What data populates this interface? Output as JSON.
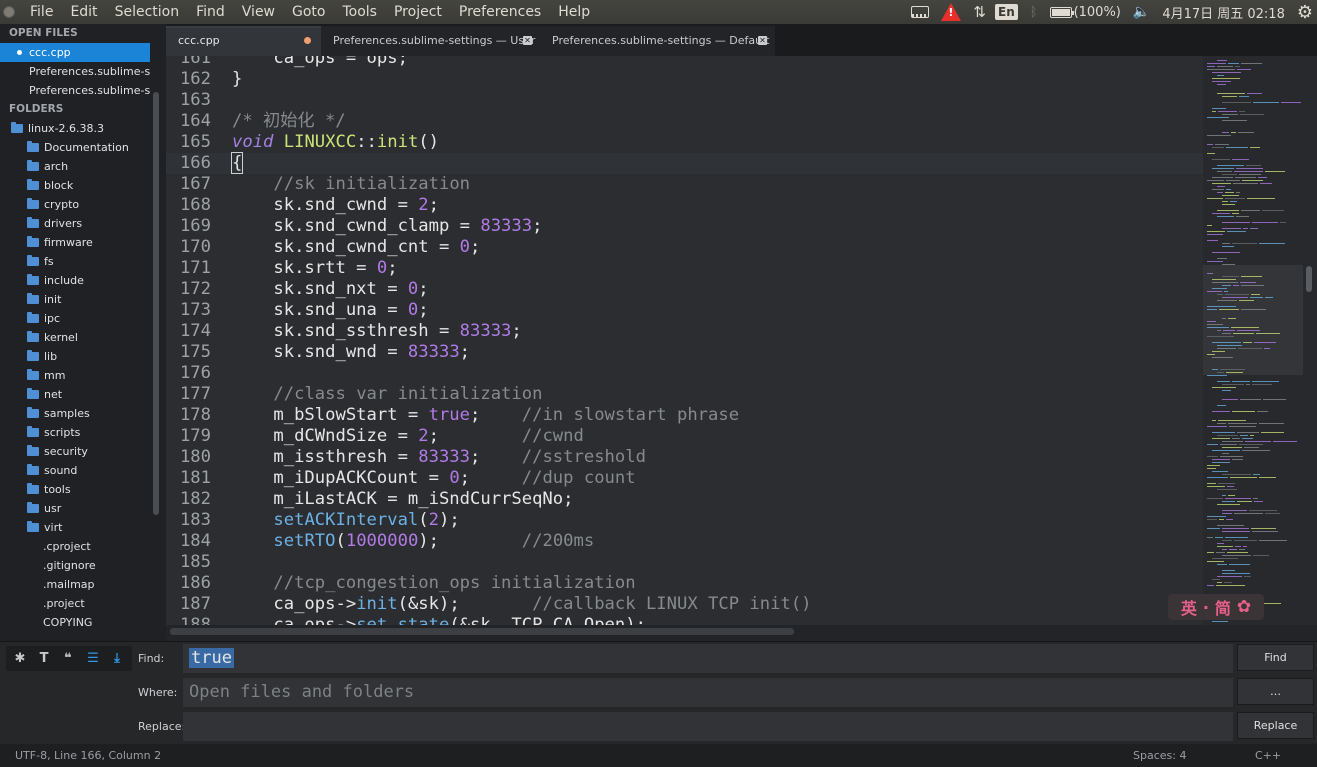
{
  "menubar": {
    "items": [
      "File",
      "Edit",
      "Selection",
      "Find",
      "View",
      "Goto",
      "Tools",
      "Project",
      "Preferences",
      "Help"
    ],
    "tray": {
      "input_method": "En",
      "battery": "(100%)",
      "datetime": "4月17日 周五 02:18"
    }
  },
  "sidebar": {
    "open_files_header": "OPEN FILES",
    "open_files": [
      "ccc.cpp",
      "Preferences.sublime-settings",
      "Preferences.sublime-settings"
    ],
    "folders_header": "FOLDERS",
    "root_folder": "linux-2.6.38.3",
    "folders": [
      "Documentation",
      "arch",
      "block",
      "crypto",
      "drivers",
      "firmware",
      "fs",
      "include",
      "init",
      "ipc",
      "kernel",
      "lib",
      "mm",
      "net",
      "samples",
      "scripts",
      "security",
      "sound",
      "tools",
      "usr",
      "virt"
    ],
    "files": [
      ".cproject",
      ".gitignore",
      ".mailmap",
      ".project",
      "COPYING"
    ]
  },
  "tabs": [
    {
      "label": "ccc.cpp",
      "active": true,
      "modified": true
    },
    {
      "label": "Preferences.sublime-settings — User",
      "active": false
    },
    {
      "label": "Preferences.sublime-settings — Default",
      "active": false
    }
  ],
  "editor": {
    "lines": [
      {
        "n": "161",
        "html": "    ca_ops = ops;"
      },
      {
        "n": "162",
        "html": "}"
      },
      {
        "n": "163",
        "html": ""
      },
      {
        "n": "164",
        "html": "<span class=\"cm\">/* 初始化 */</span>"
      },
      {
        "n": "165",
        "html": "<span class=\"k\">void</span> <span class=\"fn\">LINUXCC</span>::<span class=\"fn\">init</span>()"
      },
      {
        "n": "166",
        "html": "<span class=\"caret-box\">{</span>"
      },
      {
        "n": "167",
        "html": "    <span class=\"cm\">//sk initialization</span>"
      },
      {
        "n": "168",
        "html": "    sk.snd_cwnd = <span class=\"num\">2</span>;"
      },
      {
        "n": "169",
        "html": "    sk.snd_cwnd_clamp = <span class=\"num\">83333</span>;"
      },
      {
        "n": "170",
        "html": "    sk.snd_cwnd_cnt = <span class=\"num\">0</span>;"
      },
      {
        "n": "171",
        "html": "    sk.srtt = <span class=\"num\">0</span>;"
      },
      {
        "n": "172",
        "html": "    sk.snd_nxt = <span class=\"num\">0</span>;"
      },
      {
        "n": "173",
        "html": "    sk.snd_una = <span class=\"num\">0</span>;"
      },
      {
        "n": "174",
        "html": "    sk.snd_ssthresh = <span class=\"num\">83333</span>;"
      },
      {
        "n": "175",
        "html": "    sk.snd_wnd = <span class=\"num\">83333</span>;"
      },
      {
        "n": "176",
        "html": ""
      },
      {
        "n": "177",
        "html": "    <span class=\"cm\">//class var initialization</span>"
      },
      {
        "n": "178",
        "html": "    m_bSlowStart = <span class=\"num\">true</span>;    <span class=\"cm\">//in slowstart phrase</span>"
      },
      {
        "n": "179",
        "html": "    m_dCWndSize = <span class=\"num\">2</span>;        <span class=\"cm\">//cwnd</span>"
      },
      {
        "n": "180",
        "html": "    m_issthresh = <span class=\"num\">83333</span>;    <span class=\"cm\">//sstreshold</span>"
      },
      {
        "n": "181",
        "html": "    m_iDupACKCount = <span class=\"num\">0</span>;     <span class=\"cm\">//dup count</span>"
      },
      {
        "n": "182",
        "html": "    m_iLastACK = m_iSndCurrSeqNo;"
      },
      {
        "n": "183",
        "html": "    <span class=\"call\">setACKInterval</span>(<span class=\"num\">2</span>);"
      },
      {
        "n": "184",
        "html": "    <span class=\"call\">setRTO</span>(<span class=\"num\">1000000</span>);        <span class=\"cm\">//200ms</span>"
      },
      {
        "n": "185",
        "html": ""
      },
      {
        "n": "186",
        "html": "    <span class=\"cm\">//tcp_congestion_ops initialization</span>"
      },
      {
        "n": "187",
        "html": "    ca_ops-><span class=\"call\">init</span>(&amp;sk);       <span class=\"cm\">//callback LINUX TCP init()</span>"
      },
      {
        "n": "188",
        "html": "    ca_ops-><span class=\"call\">set_state</span>(&amp;sk, TCP_CA_Open);"
      }
    ],
    "current_line": "166"
  },
  "ime": {
    "label_en": "英",
    "label_sep": "·",
    "label_cn": "简"
  },
  "find_panel": {
    "find_label": "Find:",
    "find_value": "true",
    "where_label": "Where:",
    "where_placeholder": "Open files and folders",
    "replace_label": "Replace:",
    "replace_value": "",
    "find_button": "Find",
    "where_button": "…",
    "replace_button": "Replace"
  },
  "statusbar": {
    "position": "UTF-8, Line 166, Column 2",
    "spaces": "Spaces: 4",
    "syntax": "C++"
  },
  "colors": {
    "accent": "#1b84d6",
    "editor_bg": "#2b2d30",
    "number": "#b07be6",
    "function": "#cbe376",
    "comment": "#868a8e"
  }
}
